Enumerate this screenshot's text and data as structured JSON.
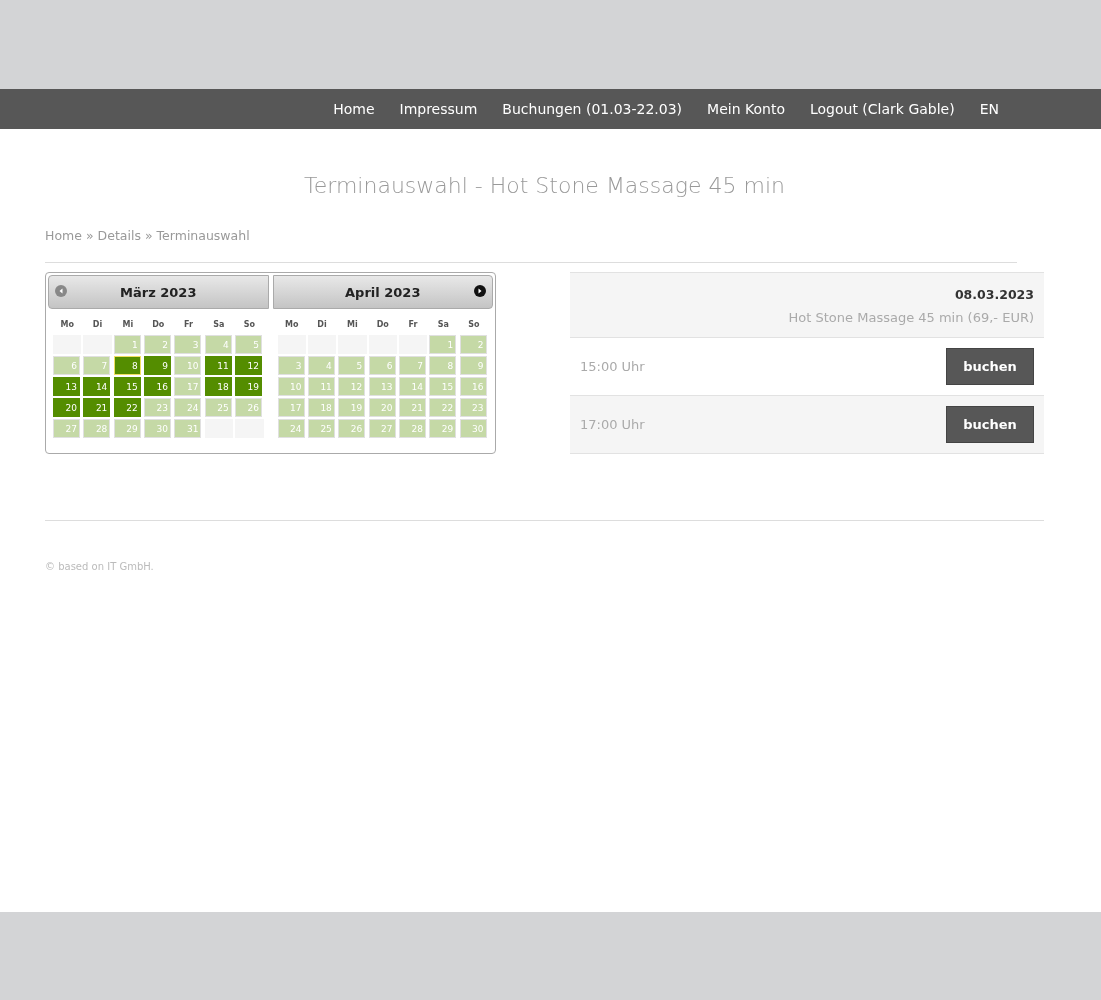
{
  "nav": {
    "items": [
      "Home",
      "Impressum",
      "Buchungen (01.03-22.03)",
      "Mein Konto",
      "Logout (Clark Gable)",
      "EN"
    ]
  },
  "title": "Terminauswahl - Hot Stone Massage 45 min",
  "breadcrumb": [
    "Home",
    "»",
    "Details",
    "»",
    "Terminauswahl"
  ],
  "calendar": {
    "months": [
      {
        "title": "März 2023",
        "kind": "prev",
        "weekdays": [
          "Mo",
          "Di",
          "Mi",
          "Do",
          "Fr",
          "Sa",
          "So"
        ],
        "weeks": [
          [
            {
              "kind": "empty"
            },
            {
              "kind": "empty"
            },
            {
              "kind": "day",
              "day": "1",
              "available": false,
              "selected": false
            },
            {
              "kind": "day",
              "day": "2",
              "available": false,
              "selected": false
            },
            {
              "kind": "day",
              "day": "3",
              "available": false,
              "selected": false
            },
            {
              "kind": "day",
              "day": "4",
              "available": false,
              "selected": false
            },
            {
              "kind": "day",
              "day": "5",
              "available": false,
              "selected": false
            }
          ],
          [
            {
              "kind": "day",
              "day": "6",
              "available": false,
              "selected": false
            },
            {
              "kind": "day",
              "day": "7",
              "available": false,
              "selected": false
            },
            {
              "kind": "day",
              "day": "8",
              "available": true,
              "selected": true
            },
            {
              "kind": "day",
              "day": "9",
              "available": true,
              "selected": false
            },
            {
              "kind": "day",
              "day": "10",
              "available": false,
              "selected": false
            },
            {
              "kind": "day",
              "day": "11",
              "available": true,
              "selected": false
            },
            {
              "kind": "day",
              "day": "12",
              "available": true,
              "selected": false
            }
          ],
          [
            {
              "kind": "day",
              "day": "13",
              "available": true,
              "selected": false
            },
            {
              "kind": "day",
              "day": "14",
              "available": true,
              "selected": false
            },
            {
              "kind": "day",
              "day": "15",
              "available": true,
              "selected": false
            },
            {
              "kind": "day",
              "day": "16",
              "available": true,
              "selected": false
            },
            {
              "kind": "day",
              "day": "17",
              "available": false,
              "selected": false
            },
            {
              "kind": "day",
              "day": "18",
              "available": true,
              "selected": false
            },
            {
              "kind": "day",
              "day": "19",
              "available": true,
              "selected": false
            }
          ],
          [
            {
              "kind": "day",
              "day": "20",
              "available": true,
              "selected": false
            },
            {
              "kind": "day",
              "day": "21",
              "available": true,
              "selected": false
            },
            {
              "kind": "day",
              "day": "22",
              "available": true,
              "selected": false
            },
            {
              "kind": "day",
              "day": "23",
              "available": false,
              "selected": false
            },
            {
              "kind": "day",
              "day": "24",
              "available": false,
              "selected": false
            },
            {
              "kind": "day",
              "day": "25",
              "available": false,
              "selected": false
            },
            {
              "kind": "day",
              "day": "26",
              "available": false,
              "selected": false
            }
          ],
          [
            {
              "kind": "day",
              "day": "27",
              "available": false,
              "selected": false
            },
            {
              "kind": "day",
              "day": "28",
              "available": false,
              "selected": false
            },
            {
              "kind": "day",
              "day": "29",
              "available": false,
              "selected": false
            },
            {
              "kind": "day",
              "day": "30",
              "available": false,
              "selected": false
            },
            {
              "kind": "day",
              "day": "31",
              "available": false,
              "selected": false
            },
            {
              "kind": "empty"
            },
            {
              "kind": "empty"
            }
          ]
        ]
      },
      {
        "title": "April 2023",
        "kind": "next",
        "weekdays": [
          "Mo",
          "Di",
          "Mi",
          "Do",
          "Fr",
          "Sa",
          "So"
        ],
        "weeks": [
          [
            {
              "kind": "empty"
            },
            {
              "kind": "empty"
            },
            {
              "kind": "empty"
            },
            {
              "kind": "empty"
            },
            {
              "kind": "empty"
            },
            {
              "kind": "day",
              "day": "1",
              "available": false,
              "selected": false
            },
            {
              "kind": "day",
              "day": "2",
              "available": false,
              "selected": false
            }
          ],
          [
            {
              "kind": "day",
              "day": "3",
              "available": false,
              "selected": false
            },
            {
              "kind": "day",
              "day": "4",
              "available": false,
              "selected": false
            },
            {
              "kind": "day",
              "day": "5",
              "available": false,
              "selected": false
            },
            {
              "kind": "day",
              "day": "6",
              "available": false,
              "selected": false
            },
            {
              "kind": "day",
              "day": "7",
              "available": false,
              "selected": false
            },
            {
              "kind": "day",
              "day": "8",
              "available": false,
              "selected": false
            },
            {
              "kind": "day",
              "day": "9",
              "available": false,
              "selected": false
            }
          ],
          [
            {
              "kind": "day",
              "day": "10",
              "available": false,
              "selected": false
            },
            {
              "kind": "day",
              "day": "11",
              "available": false,
              "selected": false
            },
            {
              "kind": "day",
              "day": "12",
              "available": false,
              "selected": false
            },
            {
              "kind": "day",
              "day": "13",
              "available": false,
              "selected": false
            },
            {
              "kind": "day",
              "day": "14",
              "available": false,
              "selected": false
            },
            {
              "kind": "day",
              "day": "15",
              "available": false,
              "selected": false
            },
            {
              "kind": "day",
              "day": "16",
              "available": false,
              "selected": false
            }
          ],
          [
            {
              "kind": "day",
              "day": "17",
              "available": false,
              "selected": false
            },
            {
              "kind": "day",
              "day": "18",
              "available": false,
              "selected": false
            },
            {
              "kind": "day",
              "day": "19",
              "available": false,
              "selected": false
            },
            {
              "kind": "day",
              "day": "20",
              "available": false,
              "selected": false
            },
            {
              "kind": "day",
              "day": "21",
              "available": false,
              "selected": false
            },
            {
              "kind": "day",
              "day": "22",
              "available": false,
              "selected": false
            },
            {
              "kind": "day",
              "day": "23",
              "available": false,
              "selected": false
            }
          ],
          [
            {
              "kind": "day",
              "day": "24",
              "available": false,
              "selected": false
            },
            {
              "kind": "day",
              "day": "25",
              "available": false,
              "selected": false
            },
            {
              "kind": "day",
              "day": "26",
              "available": false,
              "selected": false
            },
            {
              "kind": "day",
              "day": "27",
              "available": false,
              "selected": false
            },
            {
              "kind": "day",
              "day": "28",
              "available": false,
              "selected": false
            },
            {
              "kind": "day",
              "day": "29",
              "available": false,
              "selected": false
            },
            {
              "kind": "day",
              "day": "30",
              "available": false,
              "selected": false
            }
          ]
        ]
      }
    ]
  },
  "slots": {
    "date": "08.03.2023",
    "service": "Hot Stone Massage 45 min (69,- EUR)",
    "items": [
      {
        "time": "15:00 Uhr",
        "button": "buchen"
      },
      {
        "time": "17:00 Uhr",
        "button": "buchen"
      }
    ]
  },
  "footer": "© based on IT GmbH."
}
